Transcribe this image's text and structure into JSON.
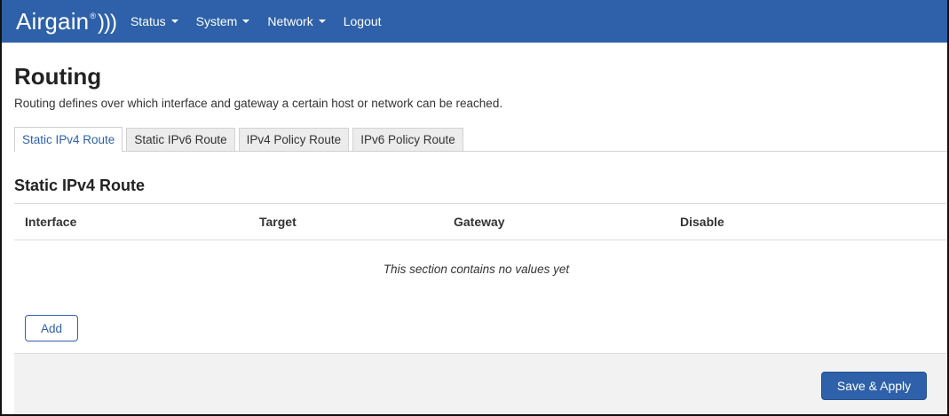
{
  "navbar": {
    "brand": "Airgain",
    "brand_reg": "®",
    "brand_waves": ")))",
    "items": [
      {
        "label": "Status",
        "has_dropdown": true
      },
      {
        "label": "System",
        "has_dropdown": true
      },
      {
        "label": "Network",
        "has_dropdown": true
      },
      {
        "label": "Logout",
        "has_dropdown": false
      }
    ]
  },
  "page": {
    "title": "Routing",
    "description": "Routing defines over which interface and gateway a certain host or network can be reached."
  },
  "tabs": [
    {
      "label": "Static IPv4 Route",
      "active": true
    },
    {
      "label": "Static IPv6 Route",
      "active": false
    },
    {
      "label": "IPv4 Policy Route",
      "active": false
    },
    {
      "label": "IPv6 Policy Route",
      "active": false
    }
  ],
  "section": {
    "title": "Static IPv4 Route",
    "columns": [
      "Interface",
      "Target",
      "Gateway",
      "Disable"
    ],
    "empty_message": "This section contains no values yet",
    "add_label": "Add"
  },
  "footer": {
    "save_apply_label": "Save & Apply"
  },
  "colors": {
    "navbar_bg": "#2e61a9",
    "accent": "#2e61a9",
    "footer_bg": "#f2f2f2"
  },
  "icons": {
    "dropdown": "caret-down-icon"
  }
}
